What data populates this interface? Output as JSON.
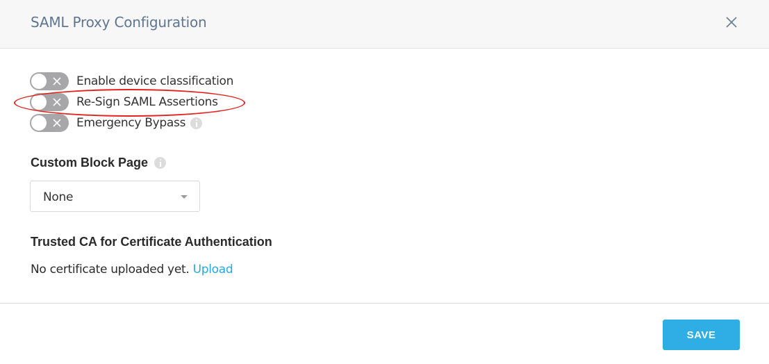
{
  "dialog": {
    "title": "SAML Proxy Configuration",
    "close_icon": "close-icon"
  },
  "toggles": [
    {
      "label": "Enable device classification",
      "enabled": false,
      "has_info": false
    },
    {
      "label": "Re-Sign SAML Assertions",
      "enabled": false,
      "has_info": false,
      "highlighted": true
    },
    {
      "label": "Emergency Bypass",
      "enabled": false,
      "has_info": true
    }
  ],
  "custom_block_page": {
    "heading": "Custom Block Page",
    "info_icon": "info-icon",
    "selected": "None"
  },
  "trusted_ca": {
    "heading": "Trusted CA for Certificate Authentication",
    "status_text": "No certificate uploaded yet.",
    "upload_link": "Upload"
  },
  "footer": {
    "save_label": "SAVE"
  },
  "colors": {
    "header_title": "#5f7590",
    "toggle_off": "#a7a7a9",
    "link": "#25a9e0",
    "save_button": "#2eaee4",
    "annotation": "#e0231e"
  }
}
